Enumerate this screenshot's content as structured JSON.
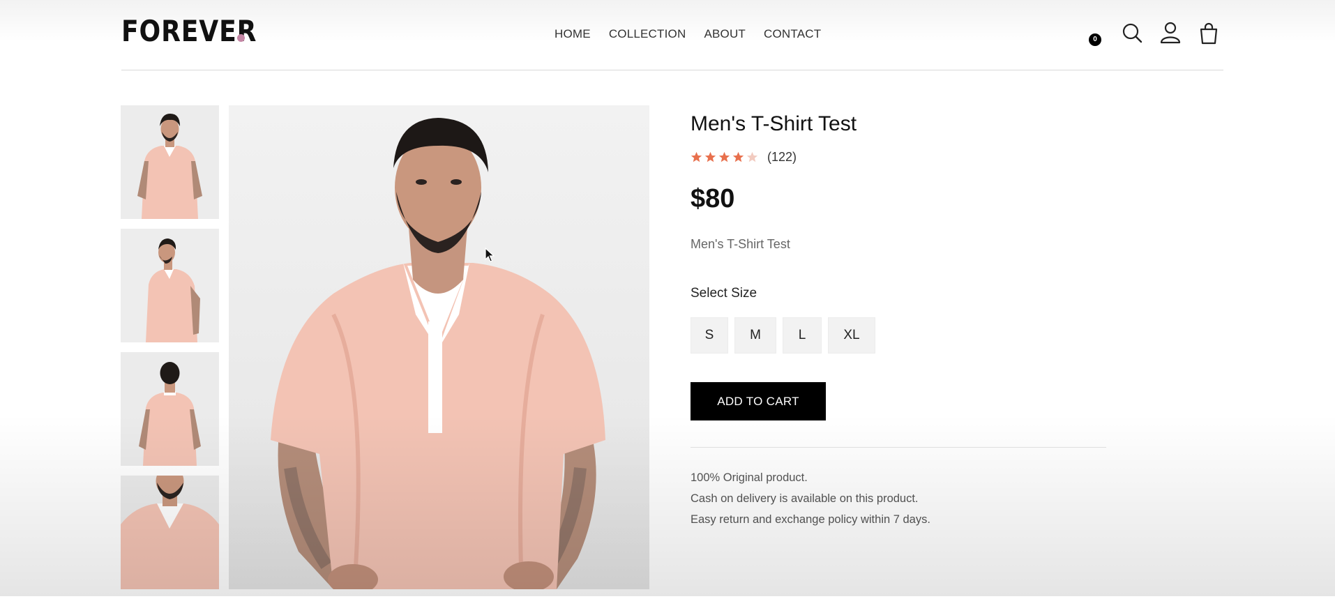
{
  "brand": {
    "logo_text": "FOREVER",
    "dot_color": "#c586a5"
  },
  "nav": {
    "links": [
      {
        "label": "HOME"
      },
      {
        "label": "COLLECTION"
      },
      {
        "label": "ABOUT"
      },
      {
        "label": "CONTACT"
      }
    ],
    "icons": [
      "search-icon",
      "profile-icon",
      "cart-icon"
    ],
    "cart_count": "0"
  },
  "gallery": {
    "thumbnails": [
      {
        "name": "thumbnail-front"
      },
      {
        "name": "thumbnail-side"
      },
      {
        "name": "thumbnail-back"
      },
      {
        "name": "thumbnail-closeup"
      }
    ],
    "shirt_color": "#f3c3b4"
  },
  "product": {
    "title": "Men's T-Shirt Test",
    "rating": 4,
    "rating_max": 5,
    "review_count": "(122)",
    "price": "$80",
    "description": "Men's T-Shirt Test",
    "size_label": "Select Size",
    "sizes": [
      "S",
      "M",
      "L",
      "XL"
    ],
    "add_to_cart": "ADD TO CART",
    "star_color": "#e8704d",
    "policies": [
      "100% Original product.",
      "Cash on delivery is available on this product.",
      "Easy return and exchange policy within 7 days."
    ]
  }
}
